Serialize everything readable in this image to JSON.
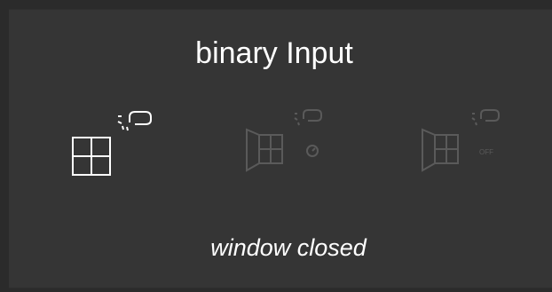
{
  "widget": {
    "title": "binary Input",
    "status_text": "window closed"
  },
  "icons": [
    {
      "name": "window-closed-icon",
      "state": "active",
      "badge": "remote-icon"
    },
    {
      "name": "window-tilted-icon",
      "state": "inactive",
      "badge": "clock-icon"
    },
    {
      "name": "window-open-icon",
      "state": "inactive",
      "badge_text": "OFF"
    }
  ],
  "colors": {
    "background": "#2b2b2b",
    "panel": "#353535",
    "active": "#ffffff",
    "inactive": "#5a5a5a"
  }
}
